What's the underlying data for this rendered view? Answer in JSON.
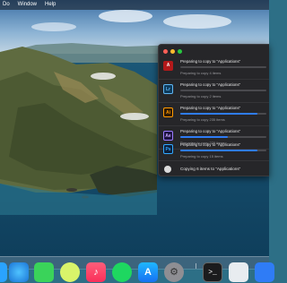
{
  "menubar": {
    "apple_symbol": "",
    "items": [
      "Do",
      "Window",
      "Help"
    ]
  },
  "copy_window": {
    "operations": [
      {
        "app_icon": "A",
        "icon_name": "acrobat-icon",
        "icon_color": "#b3191a",
        "title": "Preparing to copy to “Applications”",
        "status": "Preparing to copy 4 items",
        "progress": 0.0
      },
      {
        "app_icon": "Lr",
        "icon_name": "lightroom-icon",
        "icon_color": "#0e3b5c",
        "title": "Preparing to copy to “Applications”",
        "status": "Preparing to copy 2 items",
        "progress": 0.0
      },
      {
        "app_icon": "Ai",
        "icon_name": "illustrator-icon",
        "icon_color": "#2e1a04",
        "title": "Preparing to copy to “Applications”",
        "status": "Preparing to copy 235 items",
        "progress": 0.9
      },
      {
        "app_icon": "Ae",
        "icon_name": "after-effects-icon",
        "icon_color": "#1d1340",
        "title": "Preparing to copy to “Applications”",
        "status": "Preparing to copy 229 items",
        "progress": 0.55
      },
      {
        "app_icon": "Ps",
        "icon_name": "photoshop-icon",
        "icon_color": "#0c1f3a",
        "title": "Preparing to copy to “Applications”",
        "status": "Preparing to copy 15 items",
        "progress": 0.9
      }
    ],
    "summary": "Copying 6 items to “Applications”"
  },
  "dock": {
    "items": [
      {
        "name": "partial-left-icon",
        "glyph": ""
      },
      {
        "name": "safari-icon",
        "glyph": ""
      },
      {
        "name": "messages-icon",
        "glyph": ""
      },
      {
        "name": "speech-bubble-icon",
        "glyph": ""
      },
      {
        "name": "music-icon",
        "glyph": "♪"
      },
      {
        "name": "spotify-icon",
        "glyph": ""
      },
      {
        "name": "app-store-icon",
        "glyph": "A"
      },
      {
        "name": "system-preferences-icon",
        "glyph": "⚙"
      },
      {
        "name": "terminal-icon",
        "glyph": ">_"
      },
      {
        "name": "preview-icon",
        "glyph": ""
      },
      {
        "name": "partial-right-icon",
        "glyph": ""
      }
    ]
  },
  "colors": {
    "accent": "#2f7cf6",
    "window_bg": "#262629"
  }
}
